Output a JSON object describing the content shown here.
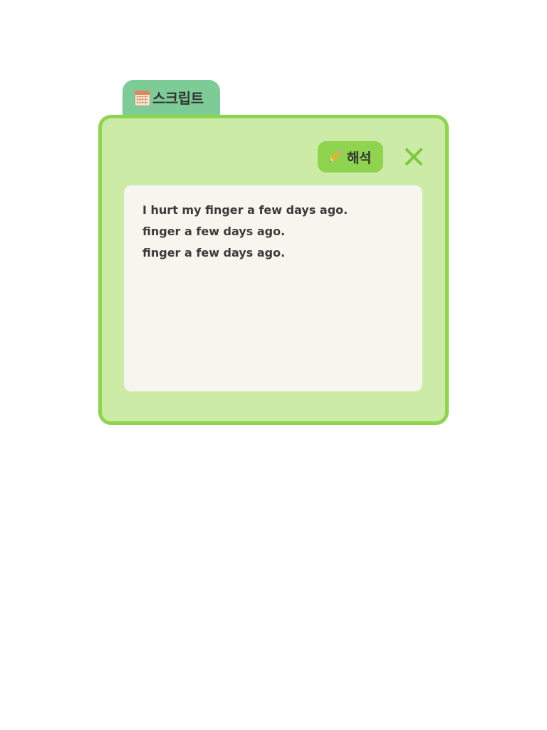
{
  "tab": {
    "icon": "calendar-icon",
    "title": "스크립트"
  },
  "toolbar": {
    "translate_label": "해석",
    "translate_icon": "pencil-icon",
    "close_icon": "close-icon"
  },
  "script": {
    "lines": [
      "I hurt my finger a few days ago.",
      "finger a few days ago.",
      "finger a few days ago."
    ]
  },
  "colors": {
    "panel_background": "#cbeba7",
    "panel_border": "#8ed44e",
    "tab_background": "#7dcb96",
    "button_background": "#8ed44e",
    "close_icon": "#7cc93e",
    "script_background": "#f7f6ee"
  }
}
